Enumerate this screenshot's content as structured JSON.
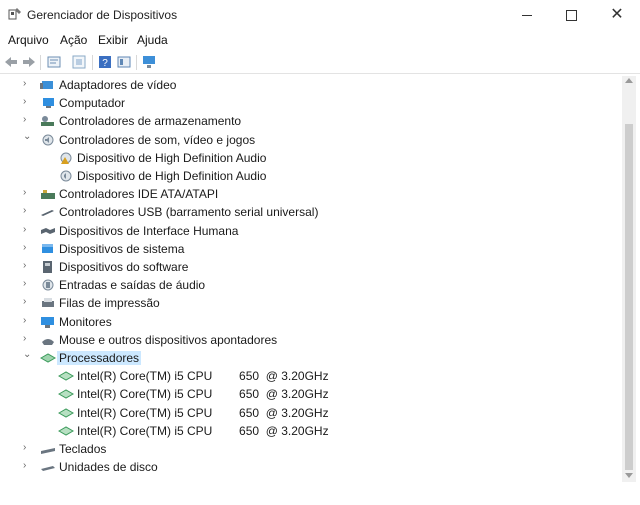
{
  "window": {
    "title": "Gerenciador de Dispositivos",
    "minimize_glyph": "—",
    "maximize_glyph": "☐",
    "close_glyph": "✕"
  },
  "menu": [
    {
      "label": "Arquivo"
    },
    {
      "label": "Ação"
    },
    {
      "label": "Exibir"
    },
    {
      "label": "Ajuda"
    }
  ],
  "toolbar": [
    {
      "icon": "back-arrow-icon",
      "color": "#9aa0a6"
    },
    {
      "icon": "forward-arrow-icon",
      "color": "#9aa0a6"
    },
    {
      "icon": "properties-icon",
      "color": "#6d8fb3"
    },
    {
      "icon": "update-driver-icon",
      "color": "#8aa9c7"
    },
    {
      "icon": "help-icon",
      "color": "#3b6fc1"
    },
    {
      "icon": "view-resources-icon",
      "color": "#5f87b5"
    },
    {
      "icon": "monitor-icon",
      "color": "#3d8fd8"
    }
  ],
  "tree": [
    {
      "label": "Adaptadores de vídeo",
      "icon": "display-adapter-icon",
      "level": 0,
      "expand": "collapsed",
      "color": "#3a8fd8"
    },
    {
      "label": "Computador",
      "icon": "computer-icon",
      "level": 0,
      "expand": "collapsed",
      "color": "#2f8fe0"
    },
    {
      "label": "Controladores de armazenamento",
      "icon": "storage-controller-icon",
      "level": 0,
      "expand": "collapsed",
      "color": "#4a7a5a"
    },
    {
      "label": "Controladores de som, vídeo e jogos",
      "icon": "sound-icon",
      "level": 0,
      "expand": "expanded",
      "color": "#7a8a99"
    },
    {
      "label": "Dispositivo de High Definition Audio",
      "icon": "audio-device-warning-icon",
      "level": 1,
      "expand": "none",
      "color": "#d8a020"
    },
    {
      "label": "Dispositivo de High Definition Audio",
      "icon": "audio-device-icon",
      "level": 1,
      "expand": "none",
      "color": "#7a8a99"
    },
    {
      "label": "Controladores IDE ATA/ATAPI",
      "icon": "ide-controller-icon",
      "level": 0,
      "expand": "collapsed",
      "color": "#4a7a5a"
    },
    {
      "label": "Controladores USB (barramento serial universal)",
      "icon": "usb-icon",
      "level": 0,
      "expand": "collapsed",
      "color": "#5a6570"
    },
    {
      "label": "Dispositivos de Interface Humana",
      "icon": "hid-icon",
      "level": 0,
      "expand": "collapsed",
      "color": "#5a6570"
    },
    {
      "label": "Dispositivos de sistema",
      "icon": "system-device-icon",
      "level": 0,
      "expand": "collapsed",
      "color": "#2f8fe0"
    },
    {
      "label": "Dispositivos do software",
      "icon": "software-device-icon",
      "level": 0,
      "expand": "collapsed",
      "color": "#5a6570"
    },
    {
      "label": "Entradas e saídas de áudio",
      "icon": "audio-io-icon",
      "level": 0,
      "expand": "collapsed",
      "color": "#7a8a99"
    },
    {
      "label": "Filas de impressão",
      "icon": "printer-icon",
      "level": 0,
      "expand": "collapsed",
      "color": "#6a7580"
    },
    {
      "label": "Monitores",
      "icon": "monitor-icon",
      "level": 0,
      "expand": "collapsed",
      "color": "#2f8fe0"
    },
    {
      "label": "Mouse e outros dispositivos apontadores",
      "icon": "mouse-icon",
      "level": 0,
      "expand": "collapsed",
      "color": "#6a7580"
    },
    {
      "label": "Processadores",
      "icon": "processor-icon",
      "level": 0,
      "expand": "expanded",
      "color": "#3a9a5a",
      "selected": true
    },
    {
      "label": "Intel(R) Core(TM) i5 CPU        650  @ 3.20GHz",
      "icon": "cpu-icon",
      "level": 1,
      "expand": "none",
      "color": "#3a9a5a"
    },
    {
      "label": "Intel(R) Core(TM) i5 CPU        650  @ 3.20GHz",
      "icon": "cpu-icon",
      "level": 1,
      "expand": "none",
      "color": "#3a9a5a"
    },
    {
      "label": "Intel(R) Core(TM) i5 CPU        650  @ 3.20GHz",
      "icon": "cpu-icon",
      "level": 1,
      "expand": "none",
      "color": "#3a9a5a"
    },
    {
      "label": "Intel(R) Core(TM) i5 CPU        650  @ 3.20GHz",
      "icon": "cpu-icon",
      "level": 1,
      "expand": "none",
      "color": "#3a9a5a"
    },
    {
      "label": "Teclados",
      "icon": "keyboard-icon",
      "level": 0,
      "expand": "collapsed",
      "color": "#6a7580"
    },
    {
      "label": "Unidades de disco",
      "icon": "disk-drive-icon",
      "level": 0,
      "expand": "collapsed",
      "color": "#6a7580"
    }
  ]
}
